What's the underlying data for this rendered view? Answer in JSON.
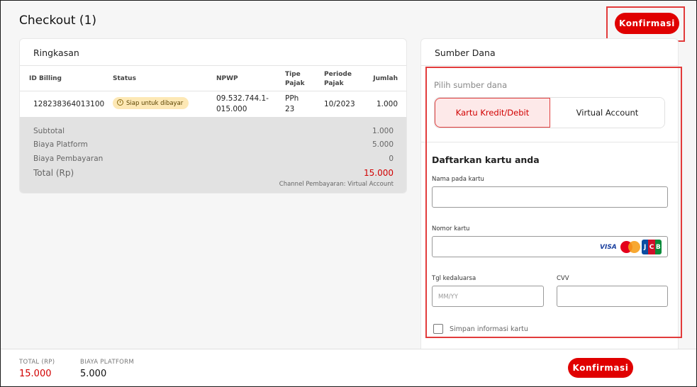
{
  "header": {
    "title": "Checkout (1)",
    "confirm_label": "Konfirmasi"
  },
  "summary": {
    "title": "Ringkasan",
    "columns": [
      "ID Billing",
      "Status",
      "NPWP",
      "Tipe Pajak",
      "Periode Pajak",
      "Jumlah"
    ],
    "row": {
      "id_billing": "128238364013100",
      "status": "Siap untuk dibayar",
      "npwp_line1": "09.532.744.1-",
      "npwp_line2": "015.000",
      "tipe_line1": "PPh",
      "tipe_line2": "23",
      "periode": "10/2023",
      "jumlah": "1.000"
    },
    "totals": {
      "subtotal_label": "Subtotal",
      "subtotal_value": "1.000",
      "platform_label": "Biaya Platform",
      "platform_value": "5.000",
      "payment_label": "Biaya Pembayaran",
      "payment_value": "0",
      "total_label": "Total (Rp)",
      "total_value": "15.000",
      "channel": "Channel Pembayaran: Virtual Account"
    }
  },
  "source": {
    "title": "Sumber Dana",
    "choose_label": "Pilih sumber dana",
    "tabs": [
      "Kartu Kredit/Debit",
      "Virtual Account"
    ],
    "form_title": "Daftarkan kartu anda",
    "name_label": "Nama pada kartu",
    "number_label": "Nomor kartu",
    "expiry_label": "Tgl kedaluarsa",
    "expiry_placeholder": "MM/YY",
    "cvv_label": "CVV",
    "save_label": "Simpan informasi kartu",
    "brands": {
      "visa": "VISA",
      "jcb": [
        "J",
        "C",
        "B"
      ]
    }
  },
  "footer": {
    "total_label": "TOTAL (RP)",
    "total_value": "15.000",
    "platform_label": "BIAYA PLATFORM",
    "platform_value": "5.000",
    "confirm_label": "Konfirmasi"
  },
  "colors": {
    "accent": "#e00000",
    "badge_bg": "#fde8b5",
    "highlight": "#e23b3b"
  }
}
